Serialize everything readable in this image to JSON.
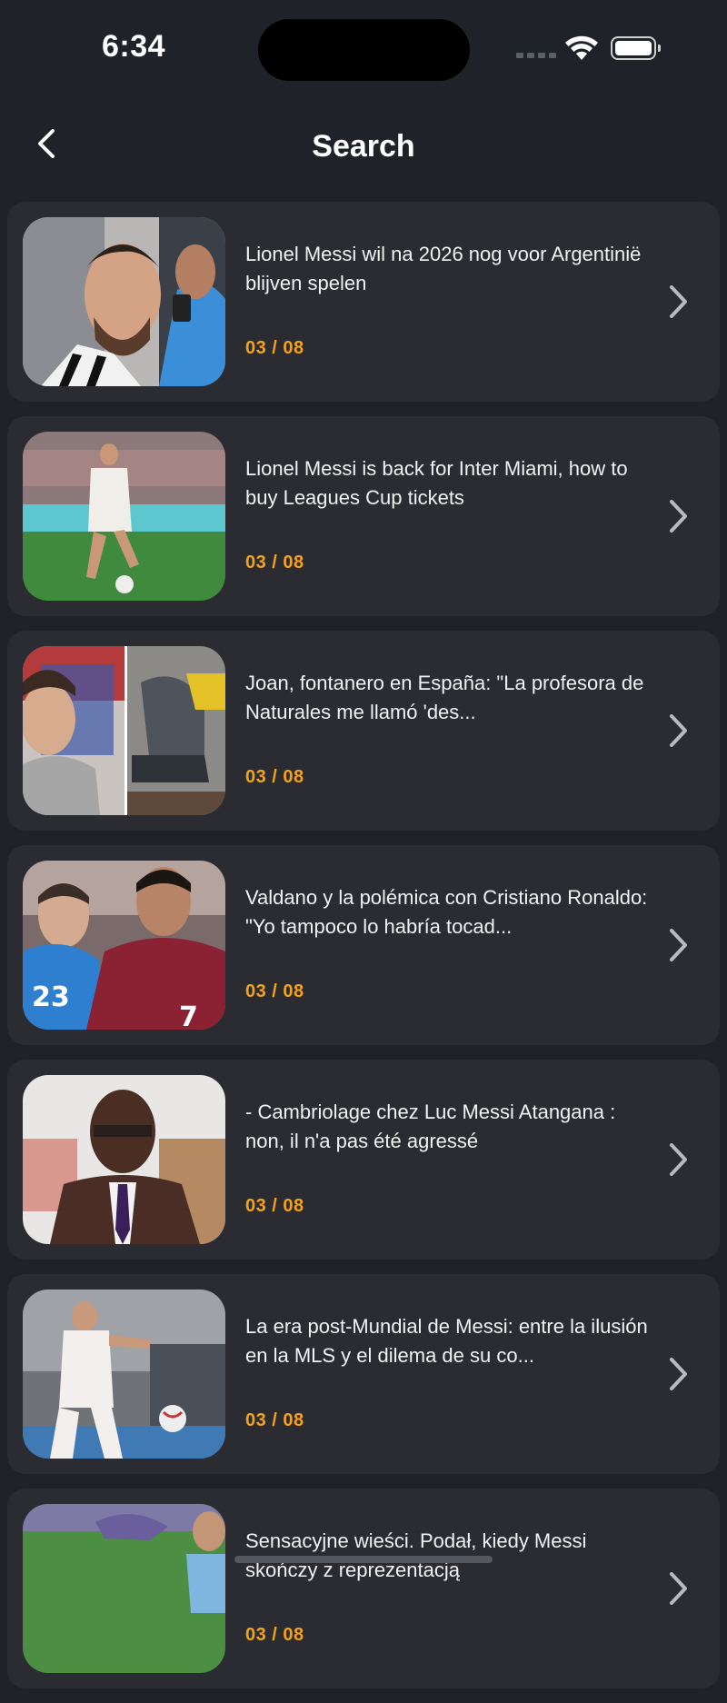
{
  "status_bar": {
    "time": "6:34"
  },
  "nav": {
    "title": "Search",
    "back_icon": "chevron-left-icon"
  },
  "articles": [
    {
      "title": "Lionel Messi wil na 2026 nog voor Argentinië blijven spelen",
      "date": "03 / 08"
    },
    {
      "title": "Lionel Messi is back for Inter Miami, how to buy Leagues Cup tickets",
      "date": "03 / 08"
    },
    {
      "title": "Joan, fontanero en España: \"La profesora de Naturales me llamó 'des...",
      "date": "03 / 08"
    },
    {
      "title": "Valdano y la polémica con Cristiano Ronaldo: \"Yo tampoco lo habría tocad...",
      "date": "03 / 08"
    },
    {
      "title": "- Cambriolage chez Luc Messi Atangana : non, il n'a pas été agressé",
      "date": "03 / 08"
    },
    {
      "title": "La era post-Mundial de Messi: entre la ilusión en la MLS y el dilema de su co...",
      "date": "03 / 08"
    },
    {
      "title": "Sensacyjne wieści. Podał, kiedy Messi skończy z reprezentacją",
      "date": "03 / 08"
    }
  ],
  "colors": {
    "background": "#1f2229",
    "card": "#2a2c32",
    "accent_date": "#f5a21a"
  }
}
